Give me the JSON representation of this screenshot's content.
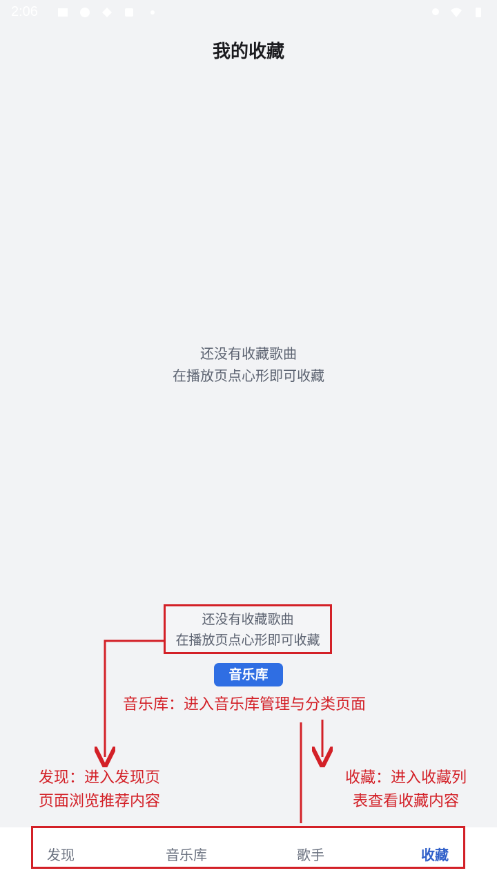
{
  "status_bar": {
    "time": "2:06",
    "left_icons": [
      "image-icon",
      "vpn-icon",
      "location-pin-icon",
      "shield-icon",
      "dot-icon"
    ],
    "right_icons": [
      "location-icon",
      "wifi-icon",
      "battery-icon"
    ]
  },
  "header": {
    "title": "我的收藏"
  },
  "empty_state": {
    "line1": "还没有收藏歌曲",
    "line2": "在播放页点心形即可收藏"
  },
  "annotation": {
    "box_line1": "还没有收藏歌曲",
    "box_line2": "在播放页点心形即可收藏",
    "library_button_label": "音乐库",
    "library_note": "音乐库：进入音乐库管理与分类页面",
    "discover_note_line1": "发现：进入发现页",
    "discover_note_line2": "页面浏览推荐内容",
    "favorites_note_line1": "收藏：进入收藏列",
    "favorites_note_line2": "表查看收藏内容",
    "accent_color": "#d32027"
  },
  "bottom_nav": {
    "items": [
      {
        "label": "发现",
        "active": false
      },
      {
        "label": "音乐库",
        "active": false
      },
      {
        "label": "歌手",
        "active": false
      },
      {
        "label": "收藏",
        "active": true
      }
    ],
    "active_color": "#2f5fc9"
  }
}
